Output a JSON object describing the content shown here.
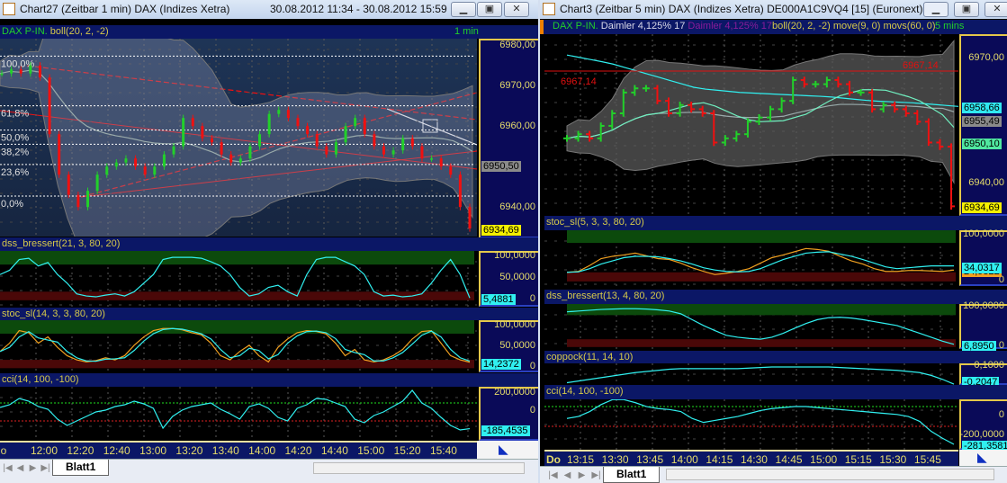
{
  "left": {
    "title": "Chart27 (Zeitbar 1 min)  DAX (Indizes Xetra)",
    "dates": "30.08.2012 11:34 - 30.08.2012 15:59",
    "header": {
      "symbol": "DAX P-IN.",
      "indicator": "boll(20, 2, -2)",
      "interval": "1 min"
    },
    "price": {
      "ylim": [
        6932.7,
        6981.6
      ],
      "closes": [
        6973,
        6974,
        6973,
        6975,
        6972,
        6958,
        6948,
        6943,
        6940,
        6944,
        6948,
        6950,
        6951,
        6952,
        6950,
        6948,
        6950,
        6953,
        6955,
        6962,
        6960,
        6957,
        6956,
        6953,
        6951,
        6952,
        6955,
        6958,
        6963,
        6964,
        6962,
        6960,
        6958,
        6955,
        6953,
        6956,
        6960,
        6962,
        6958,
        6955,
        6953,
        6954,
        6957,
        6955,
        6952,
        6952,
        6950,
        6948,
        6940,
        6934.69
      ],
      "fib": [
        {
          "label": "100,0%",
          "value": 6977.3
        },
        {
          "label": "61,8%",
          "value": 6965
        },
        {
          "label": "50,0%",
          "value": 6959
        },
        {
          "label": "38,2%",
          "value": 6955.5
        },
        {
          "label": "23,6%",
          "value": 6950.5
        },
        {
          "label": "0,0%",
          "value": 6942.7
        }
      ],
      "axis": [
        {
          "label": "6980,00",
          "value": 6980
        },
        {
          "label": "6970,00",
          "value": 6970
        },
        {
          "label": "6960,00",
          "value": 6960
        },
        {
          "label": "6940,00",
          "value": 6940
        }
      ],
      "tags": [
        {
          "label": "6950,50",
          "value": 6950.5,
          "bg": "#8a8a8a"
        },
        {
          "label": "6934,69",
          "value": 6934.69,
          "bg": "#f4f000"
        }
      ]
    },
    "dss": {
      "label": "dss_bressert(21, 3, 80, 20)",
      "ylim": [
        -15,
        115
      ],
      "values": [
        60,
        70,
        95,
        98,
        80,
        88,
        60,
        40,
        15,
        10,
        8,
        12,
        15,
        10,
        20,
        40,
        60,
        95,
        100,
        100,
        100,
        98,
        90,
        80,
        60,
        30,
        10,
        15,
        30,
        35,
        20,
        10,
        60,
        95,
        100,
        100,
        90,
        80,
        60,
        20,
        10,
        12,
        8,
        10,
        15,
        40,
        70,
        95,
        60,
        5.49
      ],
      "axis": [
        {
          "label": "100,0000",
          "value": 100
        },
        {
          "label": "50,0000",
          "value": 50
        },
        {
          "label": "0",
          "value": 0
        }
      ],
      "tag": {
        "label": "5,4881",
        "value": 5.49
      }
    },
    "stoc": {
      "label": "stoc_sl(14, 3, 3, 80, 20)",
      "ylim": [
        -10,
        115
      ],
      "values": [
        40,
        60,
        90,
        85,
        60,
        75,
        50,
        30,
        20,
        15,
        18,
        25,
        20,
        30,
        55,
        75,
        90,
        95,
        95,
        92,
        85,
        80,
        60,
        30,
        20,
        40,
        55,
        30,
        15,
        50,
        70,
        85,
        90,
        88,
        82,
        60,
        30,
        45,
        20,
        15,
        20,
        30,
        45,
        70,
        88,
        90,
        60,
        30,
        20,
        14.24
      ],
      "axis": [
        {
          "label": "100,0000",
          "value": 100
        },
        {
          "label": "50,0000",
          "value": 50
        },
        {
          "label": "0",
          "value": 0
        }
      ],
      "tag": {
        "label": "14,2372",
        "value": 14.24
      }
    },
    "cci": {
      "label": "cci(14, 100, -100)",
      "ylim": [
        -320,
        280
      ],
      "values": [
        50,
        80,
        150,
        120,
        60,
        30,
        -80,
        -150,
        -100,
        -50,
        0,
        20,
        60,
        80,
        120,
        90,
        40,
        -180,
        -50,
        20,
        60,
        80,
        100,
        30,
        -20,
        -80,
        60,
        90,
        40,
        -60,
        -100,
        40,
        80,
        150,
        140,
        100,
        60,
        -80,
        -120,
        -40,
        0,
        60,
        120,
        240,
        100,
        40,
        -60,
        -150,
        -200,
        -185.45
      ],
      "axis": [
        {
          "label": "200,0000",
          "value": 200
        },
        {
          "label": "0",
          "value": 0
        }
      ],
      "tag": {
        "label": "-185,4535",
        "value": -185.45
      }
    },
    "time": {
      "prefix": "o",
      "labels": [
        "12:00",
        "12:20",
        "12:40",
        "13:00",
        "13:20",
        "13:40",
        "14:00",
        "14:20",
        "14:40",
        "15:00",
        "15:20",
        "15:40"
      ]
    },
    "tab": "Blatt1"
  },
  "right": {
    "title": "Chart3 (Zeitbar 5 min)  DAX (Indizes Xetra) DE000A1C9VQ4 [15] (Euronext)...",
    "header": {
      "symbol": "DAX P-IN.",
      "name1": "Daimler  4,125% 17",
      "name2": "Daimler  4,125% 17",
      "indicators": "boll(20, 2, -2) move(9, 0) movs(60, 0)",
      "interval": "5 mins"
    },
    "price": {
      "ylim": [
        6932.4,
        6976
      ],
      "closes": [
        6951,
        6952,
        6951,
        6954,
        6957,
        6962,
        6963,
        6963,
        6960,
        6957,
        6959,
        6958,
        6957,
        6950,
        6951,
        6952,
        6955,
        6956,
        6958,
        6960,
        6965,
        6964,
        6964,
        6965,
        6964,
        6962,
        6962,
        6958,
        6959,
        6958,
        6957,
        6955,
        6950,
        6949,
        6934.69
      ],
      "movs60": [
        6971,
        6969,
        6966,
        6963,
        6962,
        6961.5,
        6961,
        6960,
        6959.5,
        6958.66
      ],
      "hline": {
        "label": "6967,14",
        "value": 6967.14
      },
      "axis": [
        {
          "label": "6970,00",
          "value": 6970
        },
        {
          "label": "6940,00",
          "value": 6940
        }
      ],
      "tags": [
        {
          "label": "6958,66",
          "value": 6958.66,
          "bg": "#30e8f0"
        },
        {
          "label": "6955,49",
          "value": 6955.49,
          "bg": "#8a8a8a"
        },
        {
          "label": "6950,10",
          "value": 6950.1,
          "bg": "#50e8a0"
        },
        {
          "label": "6934,69",
          "value": 6934.69,
          "bg": "#f4f000"
        }
      ]
    },
    "stoc": {
      "label": "stoc_sl(5, 3, 3, 80, 20)",
      "ylim": [
        -10,
        112
      ],
      "k": [
        20,
        22,
        35,
        50,
        55,
        58,
        62,
        56,
        50,
        48,
        40,
        30,
        22,
        15,
        18,
        22,
        28,
        40,
        52,
        58,
        65,
        72,
        70,
        66,
        55,
        45,
        38,
        28,
        22,
        22,
        24,
        24,
        23,
        22,
        24.9
      ],
      "d": [
        20,
        21,
        28,
        38,
        45,
        52,
        55,
        55,
        54,
        50,
        45,
        38,
        30,
        25,
        22,
        21,
        22,
        28,
        38,
        48,
        55,
        62,
        64,
        65,
        60,
        55,
        48,
        40,
        32,
        28,
        30,
        32,
        34,
        34,
        34.03
      ],
      "axis": [
        {
          "label": "100,0000",
          "value": 100
        },
        {
          "label": "0",
          "value": 0
        }
      ],
      "tag": {
        "label": "34,0317",
        "value": 34.03
      },
      "tag2": {
        "label": "24,9322",
        "value": 24.9
      }
    },
    "dss": {
      "label": "dss_bressert(13, 4, 80, 20)",
      "ylim": [
        -5,
        110
      ],
      "values": [
        90,
        92,
        94,
        96,
        97,
        98,
        98,
        97,
        95,
        92,
        85,
        70,
        55,
        42,
        30,
        25,
        22,
        20,
        25,
        35,
        48,
        60,
        70,
        75,
        76,
        74,
        70,
        65,
        60,
        55,
        45,
        35,
        25,
        15,
        6.895
      ],
      "axis": [
        {
          "label": "100,0000",
          "value": 100
        },
        {
          "label": "0",
          "value": 0
        }
      ],
      "tag": {
        "label": "6,8950",
        "value": 6.895
      }
    },
    "coppock": {
      "label": "coppock(11, 14, 10)",
      "ylim": [
        -0.22,
        0.164
      ],
      "values": [
        -0.18,
        -0.15,
        -0.12,
        -0.09,
        -0.06,
        -0.03,
        0,
        0.02,
        0.04,
        0.06,
        0.07,
        0.07,
        0.07,
        0.07,
        0.07,
        0.07,
        0.08,
        0.09,
        0.1,
        0.1,
        0.1,
        0.1,
        0.1,
        0.1,
        0.09,
        0.08,
        0.07,
        0.06,
        0.05,
        0.04,
        0.02,
        0,
        -0.05,
        -0.12,
        -0.2047
      ],
      "axis": [
        {
          "label": "0,1000",
          "value": 0.1
        }
      ],
      "tag": {
        "label": "-0,2047",
        "value": -0.2047
      }
    },
    "cci": {
      "label": "cci(14, 100, -100)",
      "ylim": [
        -336,
        173
      ],
      "values": [
        -20,
        0,
        50,
        120,
        170,
        170,
        140,
        100,
        80,
        70,
        50,
        -20,
        -60,
        -40,
        -20,
        0,
        30,
        60,
        80,
        90,
        100,
        100,
        90,
        80,
        70,
        60,
        50,
        40,
        30,
        20,
        0,
        -50,
        -150,
        -220,
        -281.36
      ],
      "axis": [
        {
          "label": "0",
          "value": 0
        },
        {
          "label": "-200,0000",
          "value": -200
        }
      ],
      "tag": {
        "label": "-281,3581",
        "value": -281.36
      }
    },
    "time": {
      "prefix": "Do",
      "labels": [
        "13:15",
        "13:30",
        "13:45",
        "14:00",
        "14:15",
        "14:30",
        "14:45",
        "15:00",
        "15:15",
        "15:30",
        "15:45"
      ]
    },
    "tab": "Blatt1"
  },
  "colors": {
    "up": "#22d02a",
    "down": "#f01010",
    "cyan": "#30f0f0",
    "orange": "#f0a020",
    "bandGreen": "#0c4a0c",
    "bandRed": "#4a0808",
    "axisText": "#e6dc6a"
  }
}
